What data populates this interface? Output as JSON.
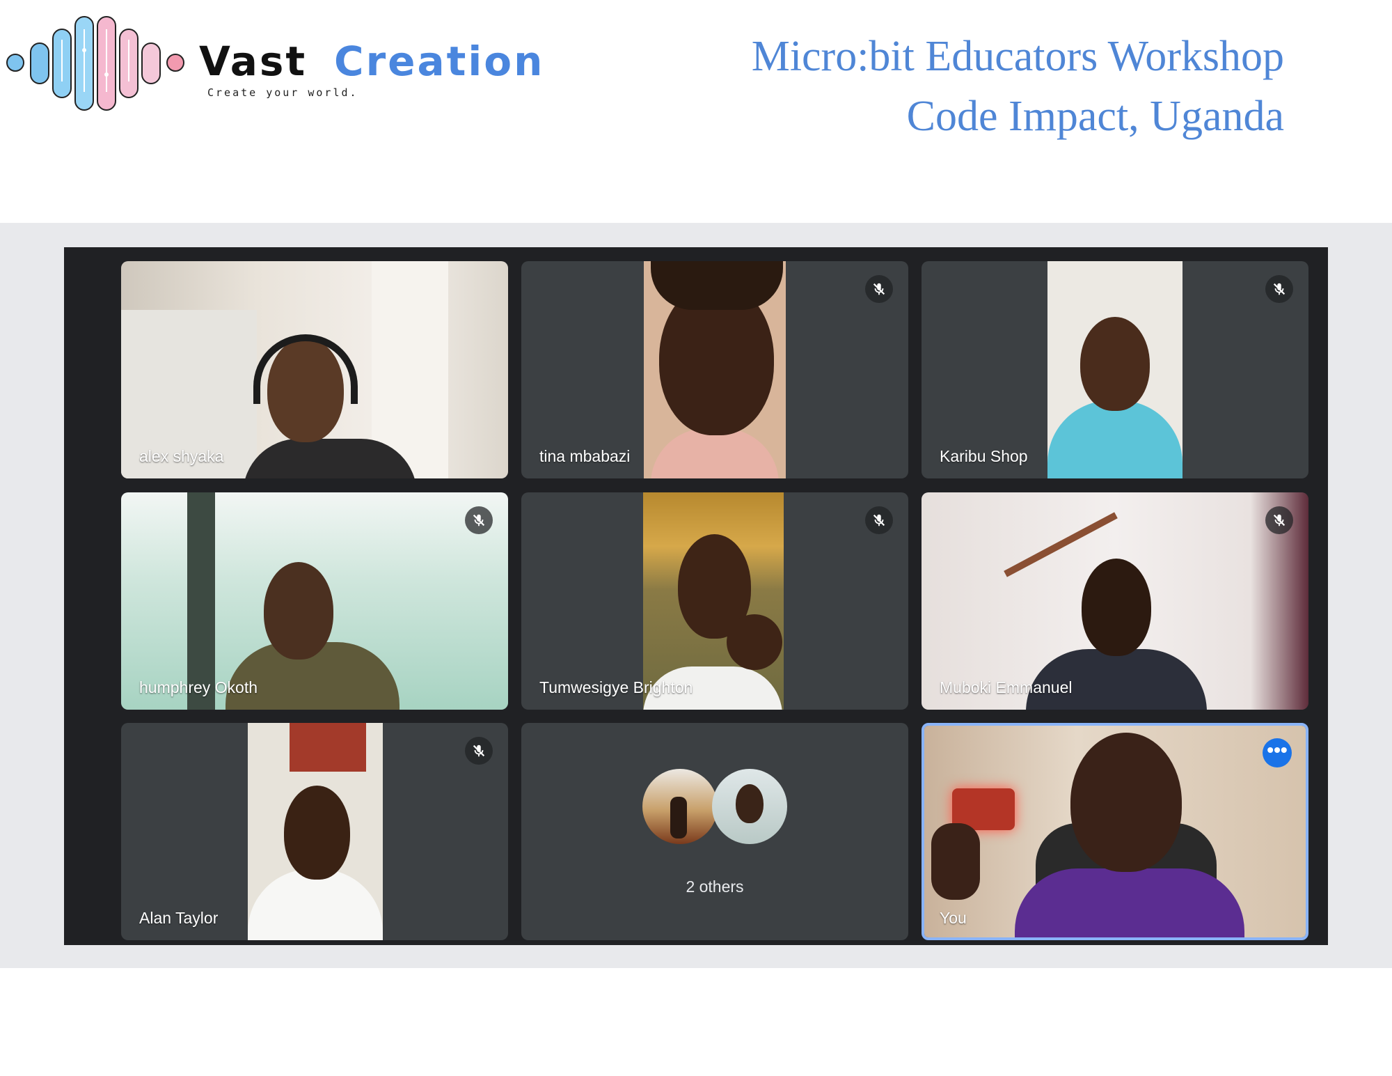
{
  "brand": {
    "name_part1": "Vast",
    "name_part2": "Creation",
    "tagline": "Create your world."
  },
  "header": {
    "title_line1": "Micro:bit Educators Workshop",
    "title_line2": "Code Impact, Uganda"
  },
  "colors": {
    "title": "#4f86d6",
    "meeting_bg": "#202124",
    "tile_bg": "#3c4043",
    "you_border": "#8ab4f8",
    "more_button": "#1a73e8"
  },
  "participants": [
    {
      "name": "alex shyaka",
      "muted": false
    },
    {
      "name": "tina mbabazi",
      "muted": true
    },
    {
      "name": "Karibu Shop",
      "muted": true
    },
    {
      "name": "humphrey Okoth",
      "muted": true
    },
    {
      "name": "Tumwesigye Brighton",
      "muted": true
    },
    {
      "name": "Muboki Emmanuel",
      "muted": true
    },
    {
      "name": "Alan Taylor",
      "muted": true
    }
  ],
  "others": {
    "label": "2 others"
  },
  "self": {
    "label": "You",
    "more_icon": "more-options-icon"
  },
  "icons": {
    "mic_off": "mic-off-icon"
  }
}
